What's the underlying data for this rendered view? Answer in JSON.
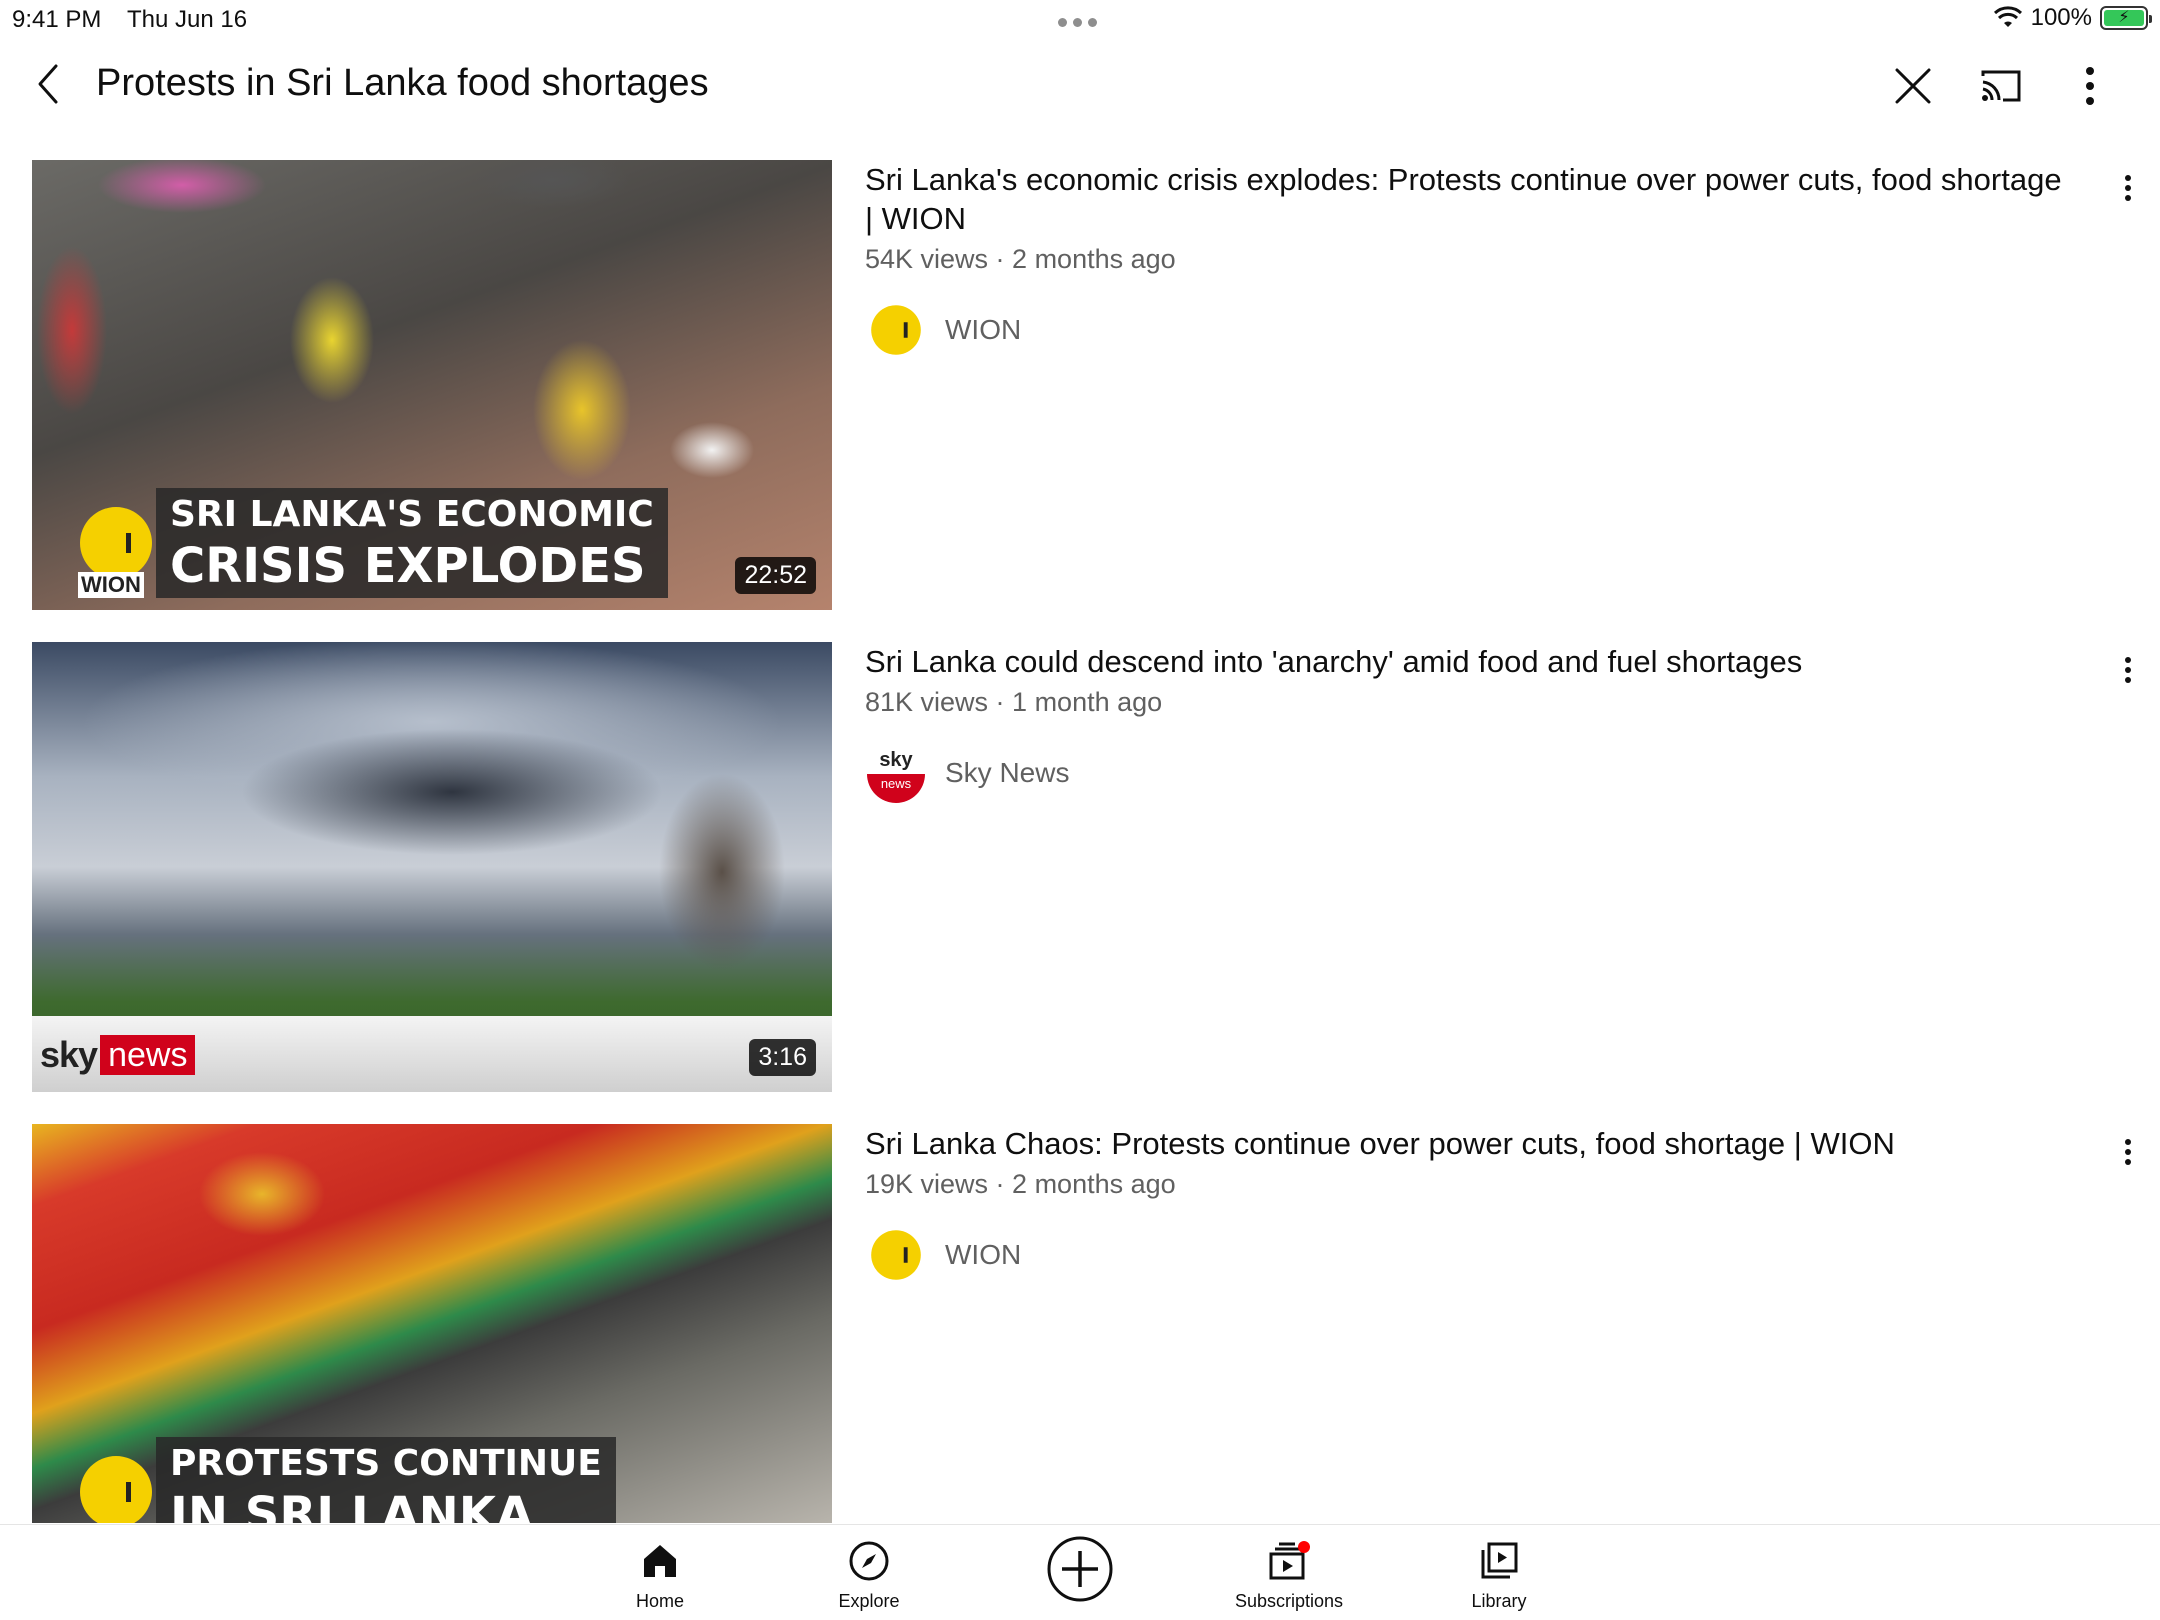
{
  "status_bar": {
    "time": "9:41 PM",
    "date": "Thu Jun 16",
    "battery": "100%",
    "icons": [
      "wifi-icon",
      "battery-charging-icon"
    ]
  },
  "header": {
    "title": "Protests in Sri Lanka food shortages",
    "icons": [
      "back-icon",
      "close-icon",
      "cast-icon",
      "more-vertical-icon"
    ]
  },
  "results": [
    {
      "title": "Sri Lanka's economic crisis explodes: Protests continue over power cuts, food shortage | WION",
      "meta": "54K views · 2 months ago",
      "channel": "WION",
      "duration": "22:52",
      "thumb_text": {
        "line1": "SRI LANKA'S ECONOMIC",
        "line2": "CRISIS EXPLODES",
        "tag": "WION"
      }
    },
    {
      "title": "Sri Lanka could descend into 'anarchy' amid food and fuel shortages",
      "meta": "81K views · 1 month ago",
      "channel": "Sky News",
      "duration": "3:16",
      "thumb_text": {
        "sky": "sky",
        "news": "news"
      }
    },
    {
      "title": "Sri Lanka Chaos: Protests continue over power cuts, food shortage | WION",
      "meta": "19K views · 2 months ago",
      "channel": "WION",
      "thumb_text": {
        "line1": "PROTESTS CONTINUE",
        "line2": "IN SRI LANKA"
      }
    }
  ],
  "tabbar": {
    "home": "Home",
    "explore": "Explore",
    "subscriptions": "Subscriptions",
    "library": "Library"
  },
  "colors": {
    "accent_red": "#ff0000",
    "wion_yellow": "#f5d000",
    "sky_red": "#d0021b",
    "battery_green": "#34c759"
  }
}
